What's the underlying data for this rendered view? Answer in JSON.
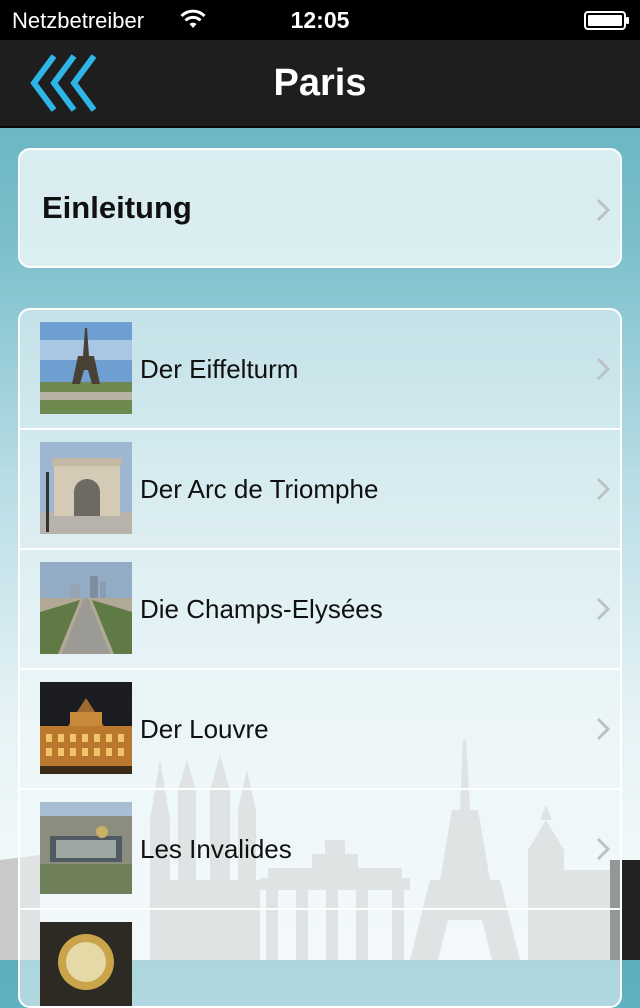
{
  "status_bar": {
    "carrier": "Netzbetreiber",
    "time": "12:05",
    "icons": [
      "wifi-icon",
      "battery-icon"
    ]
  },
  "nav": {
    "title": "Paris",
    "back_icon": "triple-chevron-left-icon",
    "accent_color": "#2fb6e8"
  },
  "intro": {
    "label": "Einleitung",
    "icon": "chevron-right-icon"
  },
  "sights": [
    {
      "label": "Der Eiffelturm"
    },
    {
      "label": "Der Arc de Triomphe"
    },
    {
      "label": "Die Champs-Elysées"
    },
    {
      "label": "Der Louvre"
    },
    {
      "label": "Les Invalides"
    },
    {
      "label": ""
    }
  ],
  "colors": {
    "background_top": "#5aaebd",
    "background_bottom": "#f7fbfc",
    "nav_background": "#1e1e1e",
    "skyline": "#c9c9c9"
  }
}
